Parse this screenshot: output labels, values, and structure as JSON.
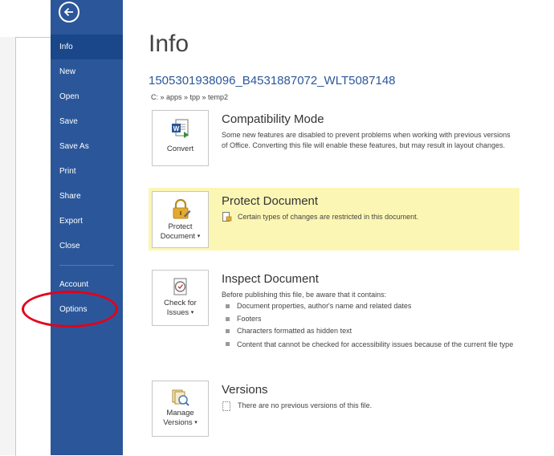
{
  "sidebar": {
    "back_label": "Back",
    "items": [
      {
        "label": "Info",
        "active": true
      },
      {
        "label": "New"
      },
      {
        "label": "Open"
      },
      {
        "label": "Save"
      },
      {
        "label": "Save As"
      },
      {
        "label": "Print"
      },
      {
        "label": "Share"
      },
      {
        "label": "Export"
      },
      {
        "label": "Close"
      },
      {
        "label": "Account"
      },
      {
        "label": "Options",
        "annotated": true
      }
    ]
  },
  "page": {
    "title": "Info",
    "filename": "1505301938096_B4531887072_WLT5087148",
    "path": "C: » apps » tpp » temp2"
  },
  "compatibility": {
    "button_label": "Convert",
    "title": "Compatibility Mode",
    "text": "Some new features are disabled to prevent problems when working with previous versions of Office. Converting this file will enable these features, but may result in layout changes."
  },
  "protect": {
    "button_line1": "Protect",
    "button_line2": "Document",
    "title": "Protect Document",
    "text": "Certain types of changes are restricted in this document."
  },
  "inspect": {
    "button_line1": "Check for",
    "button_line2": "Issues",
    "title": "Inspect Document",
    "intro": "Before publishing this file, be aware that it contains:",
    "bullets": [
      "Document properties, author's name and related dates",
      "Footers",
      "Characters formatted as hidden text",
      "Content that cannot be checked for accessibility issues because of the current file type"
    ]
  },
  "versions": {
    "button_line1": "Manage",
    "button_line2": "Versions",
    "title": "Versions",
    "text": "There are no previous versions of this file."
  },
  "colors": {
    "sidebar": "#2b579a",
    "sidebar_active": "#19478a",
    "accent": "#2b579a",
    "protect_band": "#fcf6b4",
    "annotation": "#e3001b"
  },
  "icons": [
    "back-arrow-icon",
    "word-convert-icon",
    "lock-protect-icon",
    "inspect-document-icon",
    "manage-versions-icon",
    "document-lock-small-icon",
    "versions-small-icon"
  ]
}
